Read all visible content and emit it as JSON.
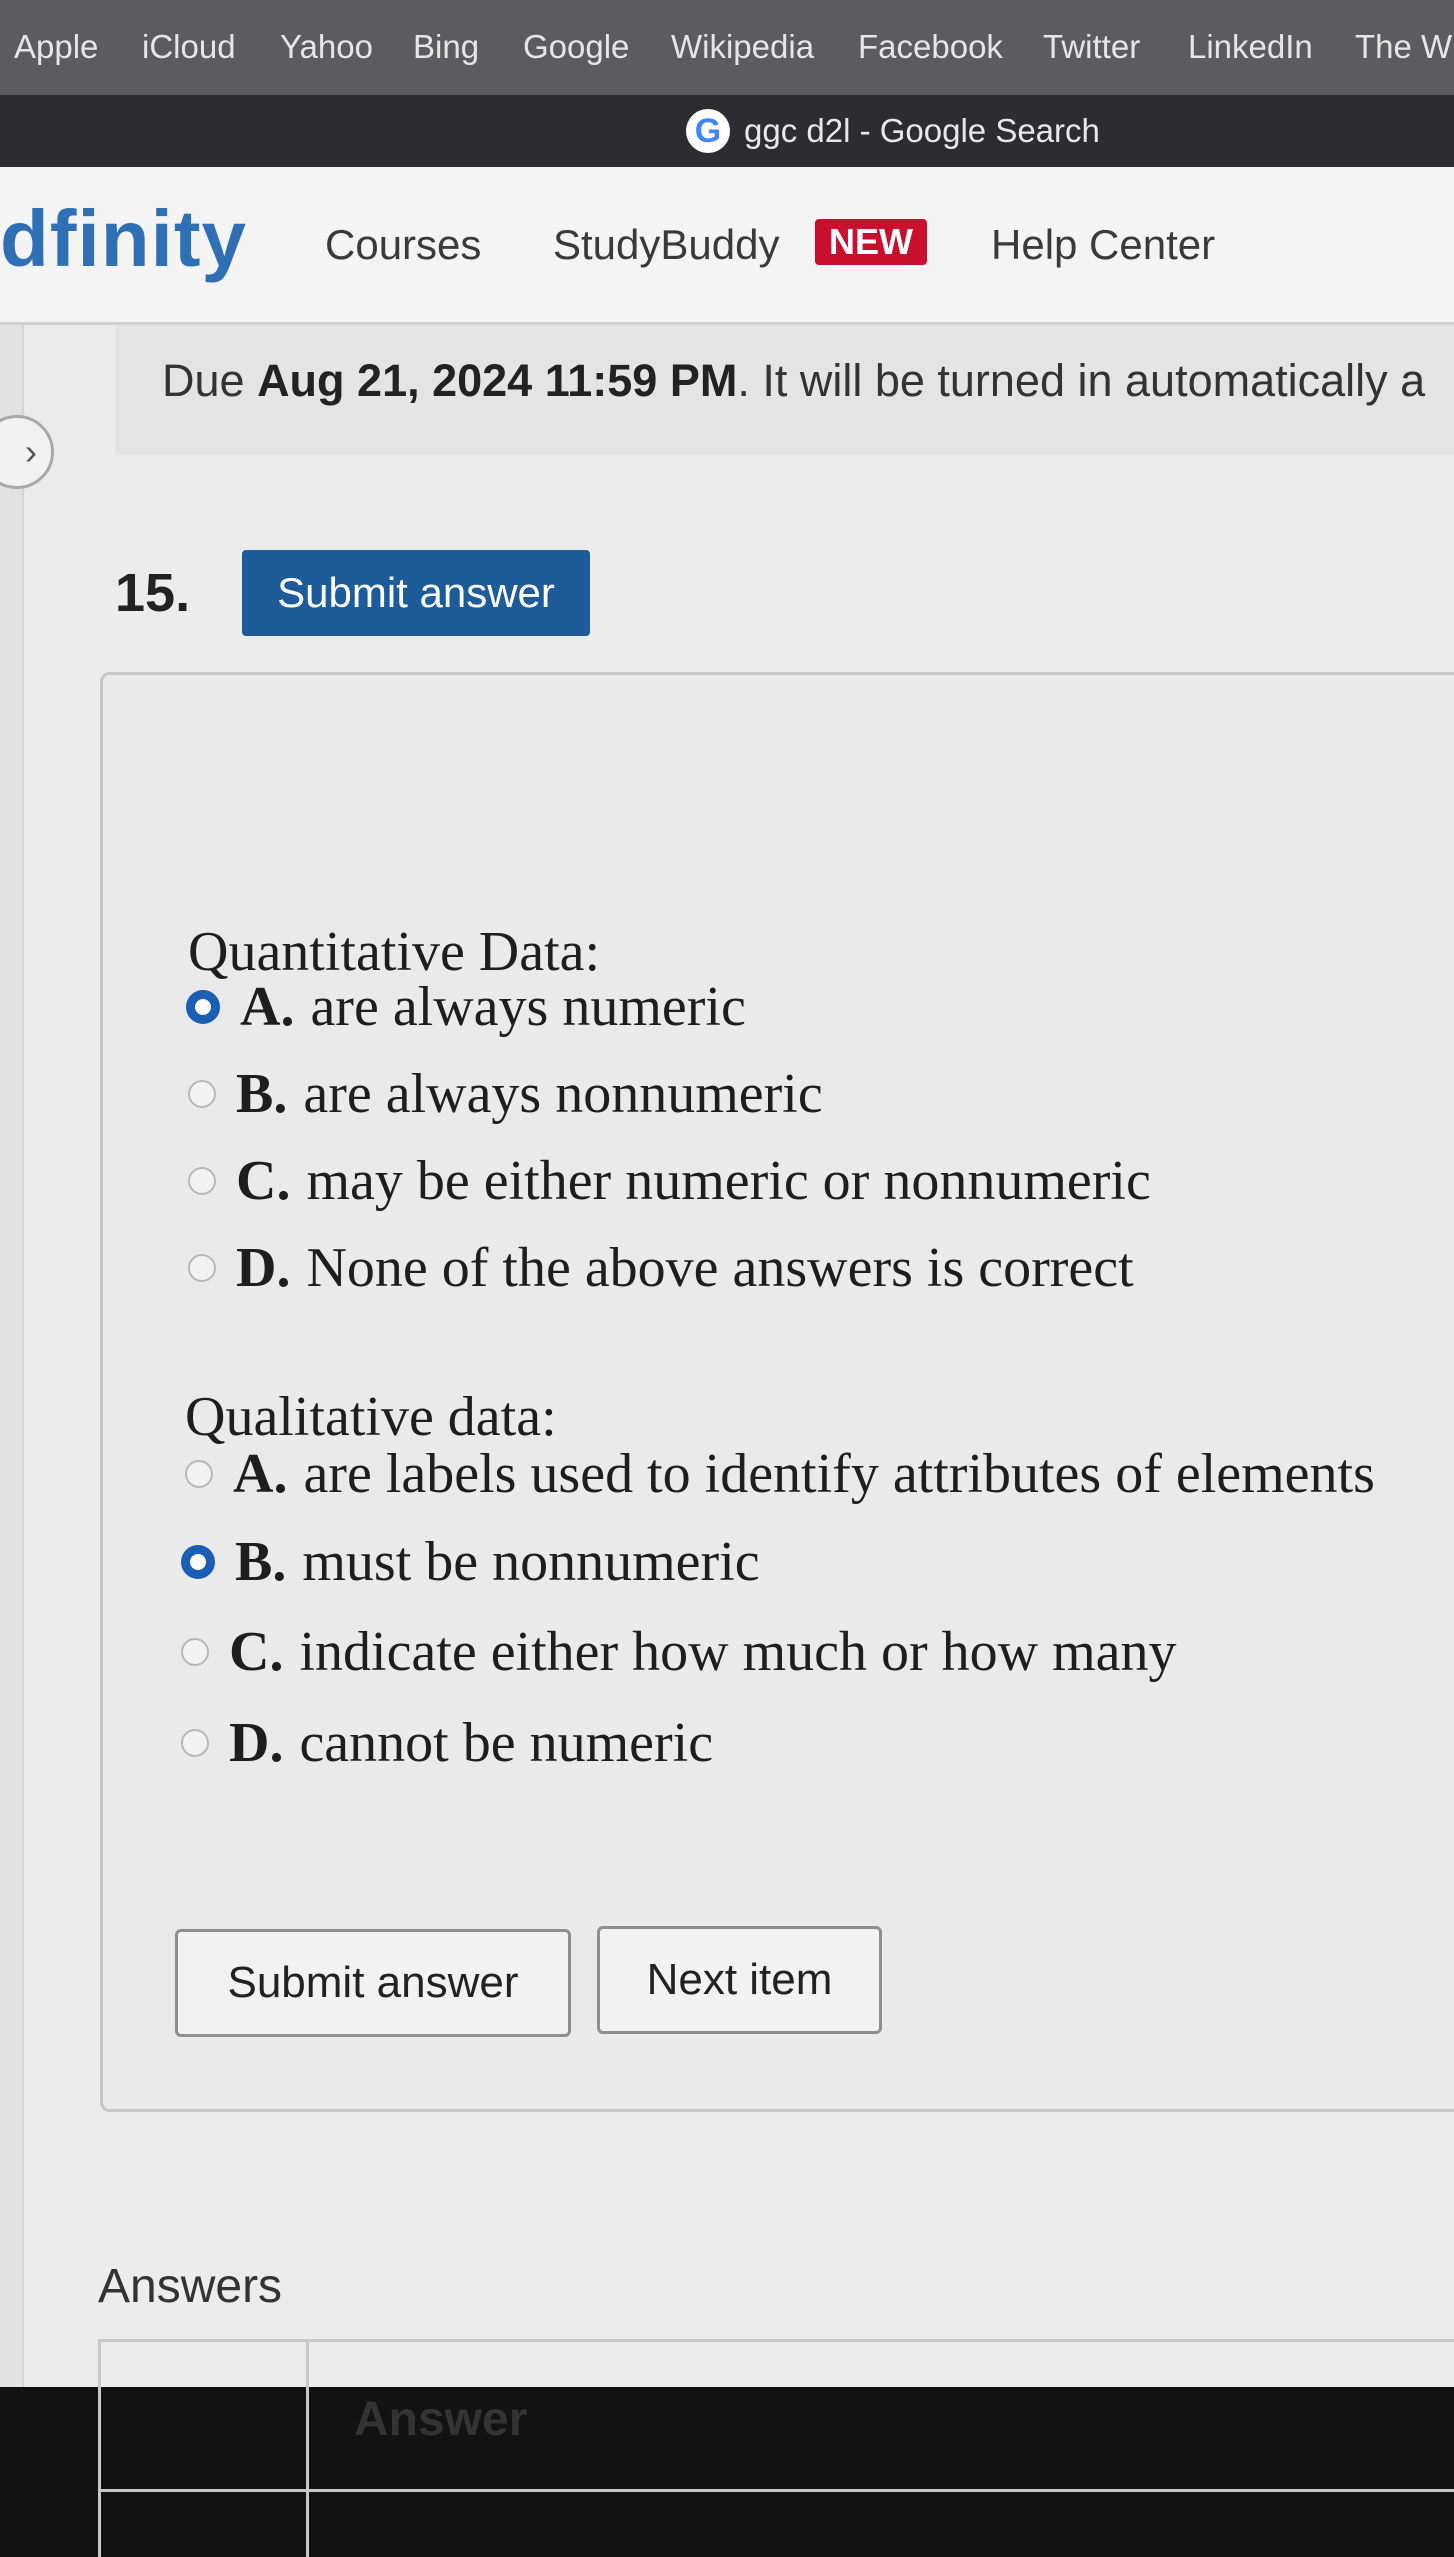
{
  "favorites": [
    "Apple",
    "iCloud",
    "Yahoo",
    "Bing",
    "Google",
    "Wikipedia",
    "Facebook",
    "Twitter",
    "LinkedIn",
    "The W"
  ],
  "browser_tab": {
    "favicon": "G",
    "title": "ggc d2l - Google Search"
  },
  "site": {
    "logo": "dfinity",
    "nav": {
      "courses": "Courses",
      "studybuddy": "StudyBuddy",
      "new_badge": "NEW",
      "help": "Help Center"
    }
  },
  "due": {
    "prefix": "Due ",
    "date": "Aug 21, 2024 11:59 PM",
    "suffix": ". It will be turned in automatically a"
  },
  "question": {
    "number": "15.",
    "submit_top": "Submit answer",
    "quantitative": {
      "title": "Quantitative Data:",
      "options": [
        {
          "letter": "A.",
          "text": "are always numeric",
          "selected": true
        },
        {
          "letter": "B.",
          "text": "are always nonnumeric",
          "selected": false
        },
        {
          "letter": "C.",
          "text": "may be either numeric or nonnumeric",
          "selected": false
        },
        {
          "letter": "D.",
          "text": "None of the above answers is correct",
          "selected": false
        }
      ]
    },
    "qualitative": {
      "title": "Qualitative data:",
      "options": [
        {
          "letter": "A.",
          "text": "are labels used to identify attributes of elements",
          "selected": false
        },
        {
          "letter": "B.",
          "text": "must be nonnumeric",
          "selected": true
        },
        {
          "letter": "C.",
          "text": "indicate either how much or how many",
          "selected": false
        },
        {
          "letter": "D.",
          "text": "cannot be numeric",
          "selected": false
        }
      ]
    },
    "submit_bottom": "Submit answer",
    "next_item": "Next item"
  },
  "answers": {
    "heading": "Answers",
    "column": "Answer"
  },
  "colors": {
    "brand_blue": "#1e5c99",
    "badge_red": "#c8102e",
    "logo_blue": "#2f6fb3"
  },
  "icons": {
    "expand": "chevron-right-icon",
    "favicon": "google-icon"
  }
}
